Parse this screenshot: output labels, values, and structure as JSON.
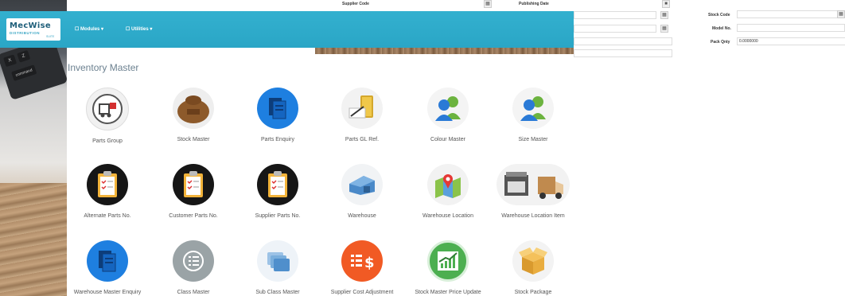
{
  "background_form": {
    "supplier_code_label": "Supplier Code",
    "publishing_date_label": "Publishing Date",
    "stock_code_label": "Stock Code",
    "model_no_label": "Model No.",
    "pack_qty_label": "Pack Qnty",
    "pack_qty_value": "0.0000000"
  },
  "header": {
    "logo_main": "MecWise",
    "logo_sub": "DISTRIBUTION",
    "logo_tag": "SUITE",
    "nav": [
      {
        "label": "☐ Modules ▾"
      },
      {
        "label": "☐ Utilities ▾"
      }
    ]
  },
  "photo_keys": [
    "X",
    "Z",
    "command"
  ],
  "panel": {
    "title": "Inventory Master",
    "tiles": [
      {
        "label": "Parts Group",
        "icon": "forklift-icon"
      },
      {
        "label": "Stock Master",
        "icon": "sack-icon"
      },
      {
        "label": "Parts Enquiry",
        "icon": "documents-icon"
      },
      {
        "label": "Parts GL Ref.",
        "icon": "folder-pen-icon"
      },
      {
        "label": "Colour Master",
        "icon": "users-icon"
      },
      {
        "label": "Size Master",
        "icon": "users-icon"
      },
      {
        "label": "Alternate Parts No.",
        "icon": "clipboard-icon"
      },
      {
        "label": "Customer Parts No.",
        "icon": "clipboard-icon"
      },
      {
        "label": "Supplier Parts No.",
        "icon": "clipboard-icon"
      },
      {
        "label": "Warehouse",
        "icon": "warehouse-icon"
      },
      {
        "label": "Warehouse Location",
        "icon": "map-pin-icon"
      },
      {
        "label": "Warehouse Location Item",
        "icon": "truck-icon"
      },
      {
        "label": "Warehouse Master Enquiry",
        "icon": "documents-icon"
      },
      {
        "label": "Class Master",
        "icon": "list-icon"
      },
      {
        "label": "Sub Class Master",
        "icon": "cards-icon"
      },
      {
        "label": "Supplier Cost Adjustment",
        "icon": "cost-list-icon"
      },
      {
        "label": "Stock Master Price Update",
        "icon": "chart-up-icon"
      },
      {
        "label": "Stock Package",
        "icon": "box-icon"
      }
    ]
  }
}
